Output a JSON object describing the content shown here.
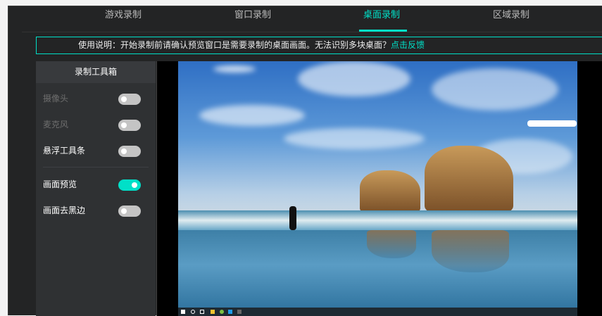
{
  "tabs": [
    {
      "label": "游戏录制"
    },
    {
      "label": "窗口录制"
    },
    {
      "label": "桌面录制"
    },
    {
      "label": "区域录制"
    }
  ],
  "active_tab": "桌面录制",
  "notice": {
    "text": "使用说明：开始录制前请确认预览窗口是需要录制的桌面画面。无法识别多块桌面？",
    "link": "点击反馈"
  },
  "toolbox": {
    "title": "录制工具箱",
    "items": [
      {
        "label": "摄像头",
        "on": false,
        "disabled": true
      },
      {
        "label": "麦克风",
        "on": false,
        "disabled": true
      },
      {
        "label": "悬浮工具条",
        "on": false,
        "disabled": false
      },
      {
        "label": "画面预览",
        "on": true,
        "disabled": false
      },
      {
        "label": "画面去黑边",
        "on": false,
        "disabled": false
      }
    ]
  },
  "accent": "#00e0c8"
}
